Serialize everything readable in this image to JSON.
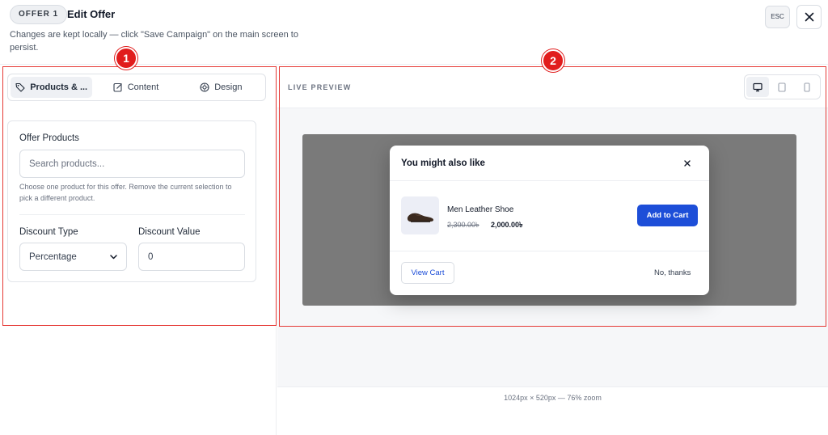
{
  "header": {
    "badge": "OFFER 1",
    "title": "Edit Offer",
    "subtitle": "Changes are kept locally — click \"Save Campaign\" on the main screen to persist.",
    "esc_label": "ESC",
    "close_icon": "close-icon"
  },
  "tabs": [
    {
      "label": "Products & ...",
      "icon": "tag-icon",
      "active": true
    },
    {
      "label": "Content",
      "icon": "edit-icon",
      "active": false
    },
    {
      "label": "Design",
      "icon": "palette-icon",
      "active": false
    }
  ],
  "form": {
    "offer_products_label": "Offer Products",
    "search_placeholder": "Search products...",
    "helper_text": "Choose one product for this offer. Remove the current selection to pick a different product.",
    "discount_type_label": "Discount Type",
    "discount_type_value": "Percentage",
    "discount_value_label": "Discount Value",
    "discount_value": "0"
  },
  "preview": {
    "label": "LIVE PREVIEW",
    "devices": [
      {
        "name": "desktop",
        "icon": "desktop-icon",
        "active": true
      },
      {
        "name": "tablet",
        "icon": "tablet-icon",
        "active": false
      },
      {
        "name": "mobile",
        "icon": "mobile-icon",
        "active": false
      }
    ],
    "zoom_note": "1024px × 520px — 76% zoom"
  },
  "popup": {
    "title": "You might also like",
    "product_name": "Men Leather Shoe",
    "old_price": "2,300.00৳",
    "new_price": "2,000.00৳",
    "add_to_cart": "Add to Cart",
    "view_cart": "View Cart",
    "no_thanks": "No, thanks"
  },
  "annotations": {
    "badge1": "1",
    "badge2": "2"
  },
  "colors": {
    "accent": "#1d4ed8",
    "annotation": "#e53935",
    "stage_bg": "#7a7a7a"
  }
}
